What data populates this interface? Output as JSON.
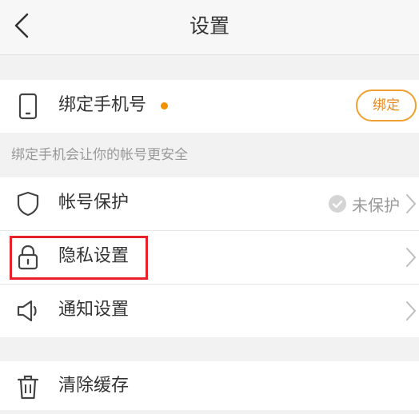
{
  "nav": {
    "title": "设置",
    "back_icon": "chevron-left-icon"
  },
  "phone_section": {
    "label": "绑定手机号",
    "icon": "phone-icon",
    "dot_color": "#f29100",
    "bind_button": "绑定",
    "hint": "绑定手机会让你的帐号更安全"
  },
  "account_section": {
    "items": [
      {
        "label": "帐号保护",
        "icon": "shield-icon",
        "status": "未保护"
      },
      {
        "label": "隐私设置",
        "icon": "lock-icon"
      },
      {
        "label": "通知设置",
        "icon": "megaphone-icon"
      }
    ]
  },
  "cache_section": {
    "label": "清除缓存",
    "icon": "trash-icon"
  },
  "colors": {
    "accent": "#f0a030",
    "highlight": "#e8202a"
  }
}
